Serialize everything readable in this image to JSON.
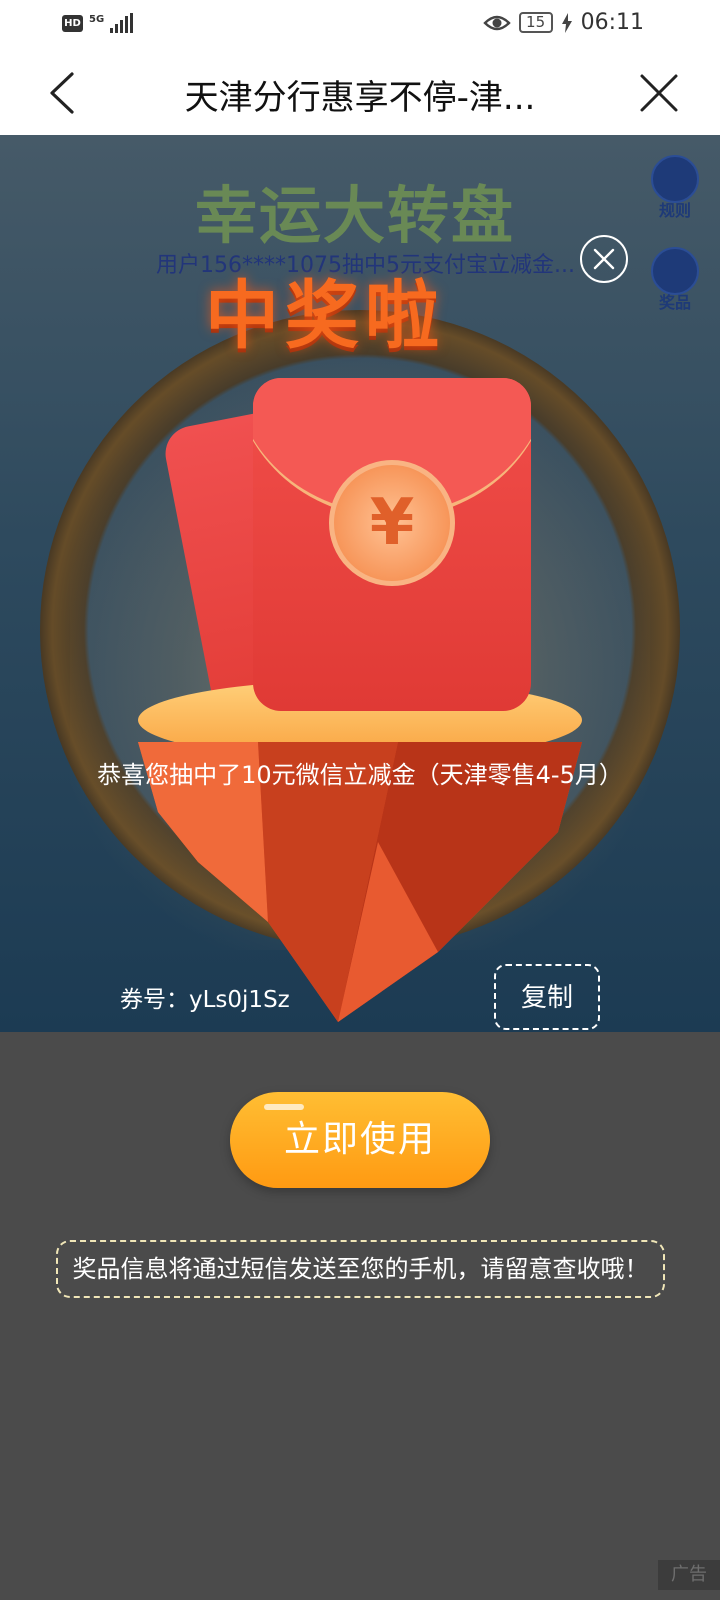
{
  "status_bar": {
    "hd": "HD",
    "network": "5G",
    "battery": "15",
    "time": "06:11"
  },
  "title_bar": {
    "title": "天津分行惠享不停-津..."
  },
  "game": {
    "title": "幸运大转盘",
    "rules_label": "规则",
    "prizes_label": "奖品",
    "marquee": "用户156****1075抽中5元支付宝立减金..."
  },
  "modal": {
    "headline": "中奖啦",
    "coin_symbol": "¥",
    "congrats": "恭喜您抽中了10元微信立减金（天津零售4-5月）",
    "ticket_label": "券号：yLs0j1Sz",
    "copy_label": "复制"
  },
  "bottom": {
    "use_label": "立即使用",
    "notice": "奖品信息将通过短信发送至您的手机，请留意查收哦！",
    "ad_label": "广告"
  }
}
